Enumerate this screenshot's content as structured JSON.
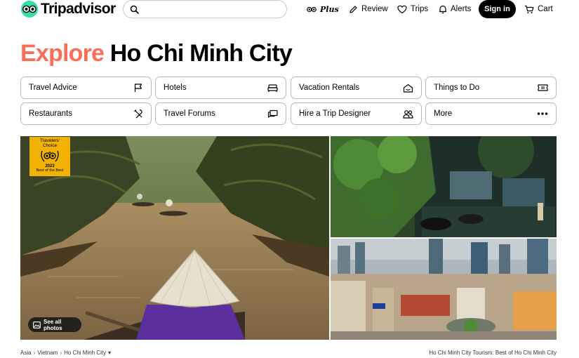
{
  "brand": {
    "name": "Tripadvisor"
  },
  "search": {
    "placeholder": ""
  },
  "nav": {
    "plus": "Plus",
    "review": "Review",
    "trips": "Trips",
    "alerts": "Alerts",
    "signin": "Sign in",
    "cart": "Cart"
  },
  "heading": {
    "accent": "Explore",
    "place": "Ho Chi Minh City"
  },
  "categories": [
    {
      "label": "Travel Advice",
      "icon": "flag-icon"
    },
    {
      "label": "Hotels",
      "icon": "bed-icon"
    },
    {
      "label": "Vacation Rentals",
      "icon": "house-icon"
    },
    {
      "label": "Things to Do",
      "icon": "ticket-icon"
    },
    {
      "label": "Restaurants",
      "icon": "fork-knife-icon"
    },
    {
      "label": "Travel Forums",
      "icon": "chat-icon"
    },
    {
      "label": "Hire a Trip Designer",
      "icon": "people-icon"
    },
    {
      "label": "More",
      "icon": "ellipsis-icon"
    }
  ],
  "badge": {
    "line1": "Travelers'",
    "line2": "Choice",
    "year": "2023",
    "sub": "Best of the Best"
  },
  "gallery": {
    "see_all": "See all photos"
  },
  "breadcrumb": [
    "Asia",
    "Vietnam",
    "Ho Chi Minh City"
  ],
  "footer_title": "Ho Chi Minh City Tourism: Best of Ho Chi Minh City",
  "colors": {
    "accent": "#fa6e57",
    "brand_green": "#34e0a1",
    "badge_yellow": "#f2b203"
  }
}
